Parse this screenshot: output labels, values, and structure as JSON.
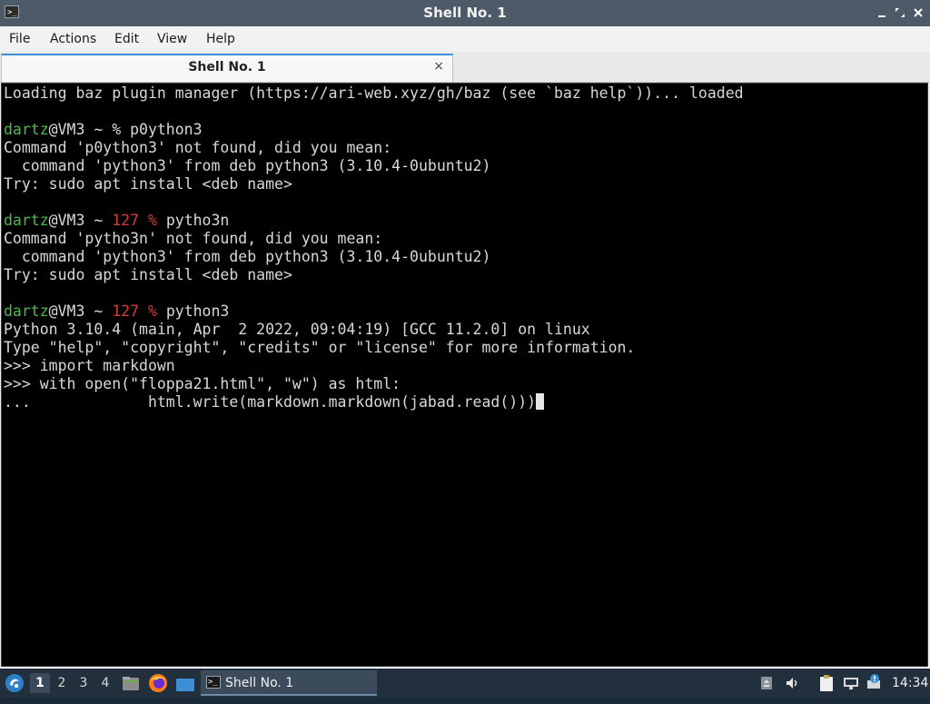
{
  "window": {
    "title": "Shell No. 1",
    "controls": [
      "minimize",
      "maximize",
      "close"
    ]
  },
  "menu": {
    "items": [
      "File",
      "Actions",
      "Edit",
      "View",
      "Help"
    ]
  },
  "tabs": [
    {
      "label": "Shell No. 1",
      "close": "×"
    }
  ],
  "terminal": {
    "lines": [
      [
        {
          "t": "Loading baz plugin manager (https://ari-web.xyz/gh/baz (see `baz help`))... loaded"
        }
      ],
      [],
      [
        {
          "t": "dartz",
          "c": "green"
        },
        {
          "t": "@VM3 ~ % p0ython3"
        }
      ],
      [
        {
          "t": "Command 'p0ython3' not found, did you mean:"
        }
      ],
      [
        {
          "t": "  command 'python3' from deb python3 (3.10.4-0ubuntu2)"
        }
      ],
      [
        {
          "t": "Try: sudo apt install <deb name>"
        }
      ],
      [],
      [
        {
          "t": "dartz",
          "c": "green"
        },
        {
          "t": "@VM3 ~ "
        },
        {
          "t": "127 %",
          "c": "red"
        },
        {
          "t": " pytho3n"
        }
      ],
      [
        {
          "t": "Command 'pytho3n' not found, did you mean:"
        }
      ],
      [
        {
          "t": "  command 'python3' from deb python3 (3.10.4-0ubuntu2)"
        }
      ],
      [
        {
          "t": "Try: sudo apt install <deb name>"
        }
      ],
      [],
      [
        {
          "t": "dartz",
          "c": "green"
        },
        {
          "t": "@VM3 ~ "
        },
        {
          "t": "127 %",
          "c": "red"
        },
        {
          "t": " python3"
        }
      ],
      [
        {
          "t": "Python 3.10.4 (main, Apr  2 2022, 09:04:19) [GCC 11.2.0] on linux"
        }
      ],
      [
        {
          "t": "Type \"help\", \"copyright\", \"credits\" or \"license\" for more information."
        }
      ],
      [
        {
          "t": ">>> import markdown"
        }
      ],
      [
        {
          "t": ">>> with open(\"floppa21.html\", \"w\") as html:"
        }
      ],
      [
        {
          "t": "...             html.write(markdown.markdown(jabad.read()))"
        },
        {
          "cursor": true
        }
      ]
    ]
  },
  "taskbar": {
    "workspaces": [
      "1",
      "2",
      "3",
      "4"
    ],
    "active_workspace": "1",
    "launchers": [
      "file-manager-icon",
      "firefox-icon",
      "desktop-icon"
    ],
    "task_label": "Shell No. 1",
    "tray_icons": [
      "usb-icon",
      "volume-icon",
      "clipboard-icon",
      "network-icon",
      "notification-icon"
    ],
    "clock": "14:34"
  }
}
